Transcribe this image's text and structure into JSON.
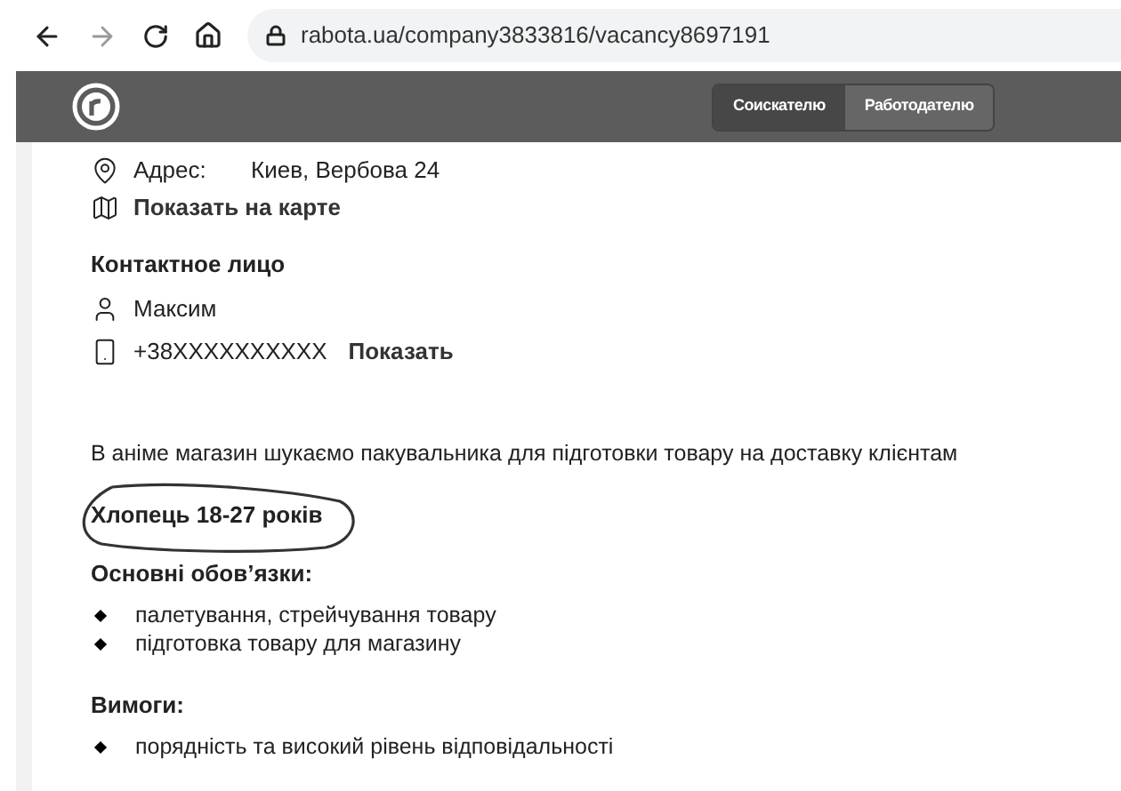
{
  "browser": {
    "url": "rabota.ua/company3833816/vacancy8697191"
  },
  "header": {
    "tabs": [
      {
        "label": "Соискателю",
        "selected": true
      },
      {
        "label": "Работодателю",
        "selected": false
      }
    ]
  },
  "address": {
    "label": "Адрес:",
    "value": "Киев, Вербова 24",
    "map_link": "Показать на карте"
  },
  "contact": {
    "heading": "Контактное лицо",
    "name": "Максим",
    "phone": "+38XXXXXXXXXX",
    "show_link": "Показать"
  },
  "description": "В аніме магазин шукаємо пакувальника для підготовки товару на доставку клієнтам",
  "highlight": "Хлопець 18-27 років",
  "sections": [
    {
      "heading": "Основні обов’язки:",
      "items": [
        "палетування, стрейчування товару",
        "підготовка товару для магазину"
      ]
    },
    {
      "heading": "Вимоги:",
      "items": [
        "порядність та високий рівень відповідальності"
      ]
    }
  ]
}
